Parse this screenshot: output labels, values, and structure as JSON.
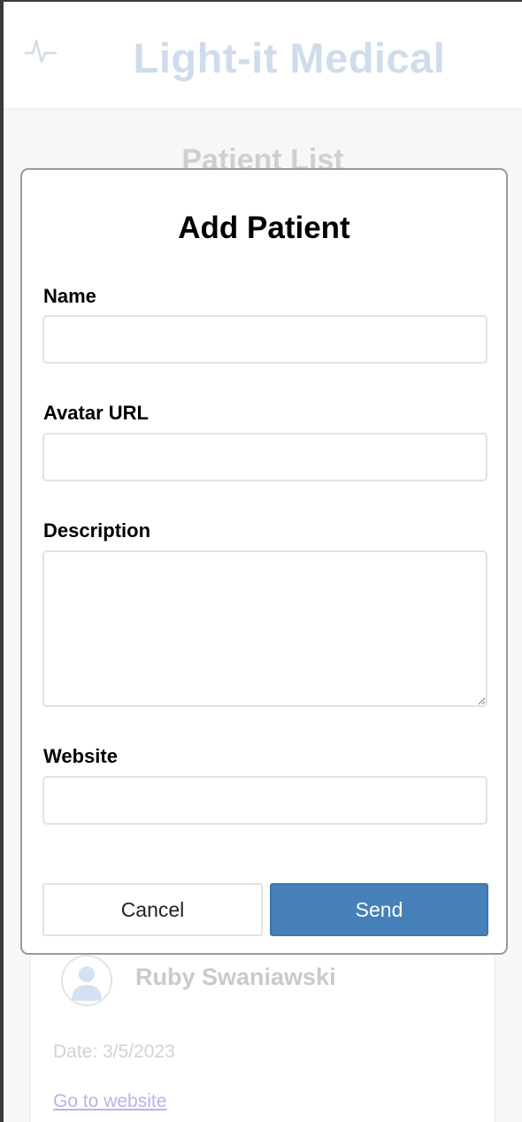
{
  "header": {
    "title": "Light-it Medical",
    "logo_icon": "activity-pulse-icon",
    "title_color": "#cfdceb"
  },
  "page": {
    "title": "Patient List"
  },
  "patient_card": {
    "name": "Ruby Swaniawski",
    "date": "Date: 3/5/2023",
    "link_label": "Go to website",
    "avatar_icon": "user-avatar-icon"
  },
  "modal": {
    "title": "Add Patient",
    "fields": {
      "name": {
        "label": "Name",
        "value": "",
        "placeholder": ""
      },
      "avatar_url": {
        "label": "Avatar URL",
        "value": "",
        "placeholder": ""
      },
      "description": {
        "label": "Description",
        "value": "",
        "placeholder": ""
      },
      "website": {
        "label": "Website",
        "value": "",
        "placeholder": ""
      }
    },
    "buttons": {
      "cancel": "Cancel",
      "send": "Send"
    },
    "accent_color": "#4580b8"
  }
}
